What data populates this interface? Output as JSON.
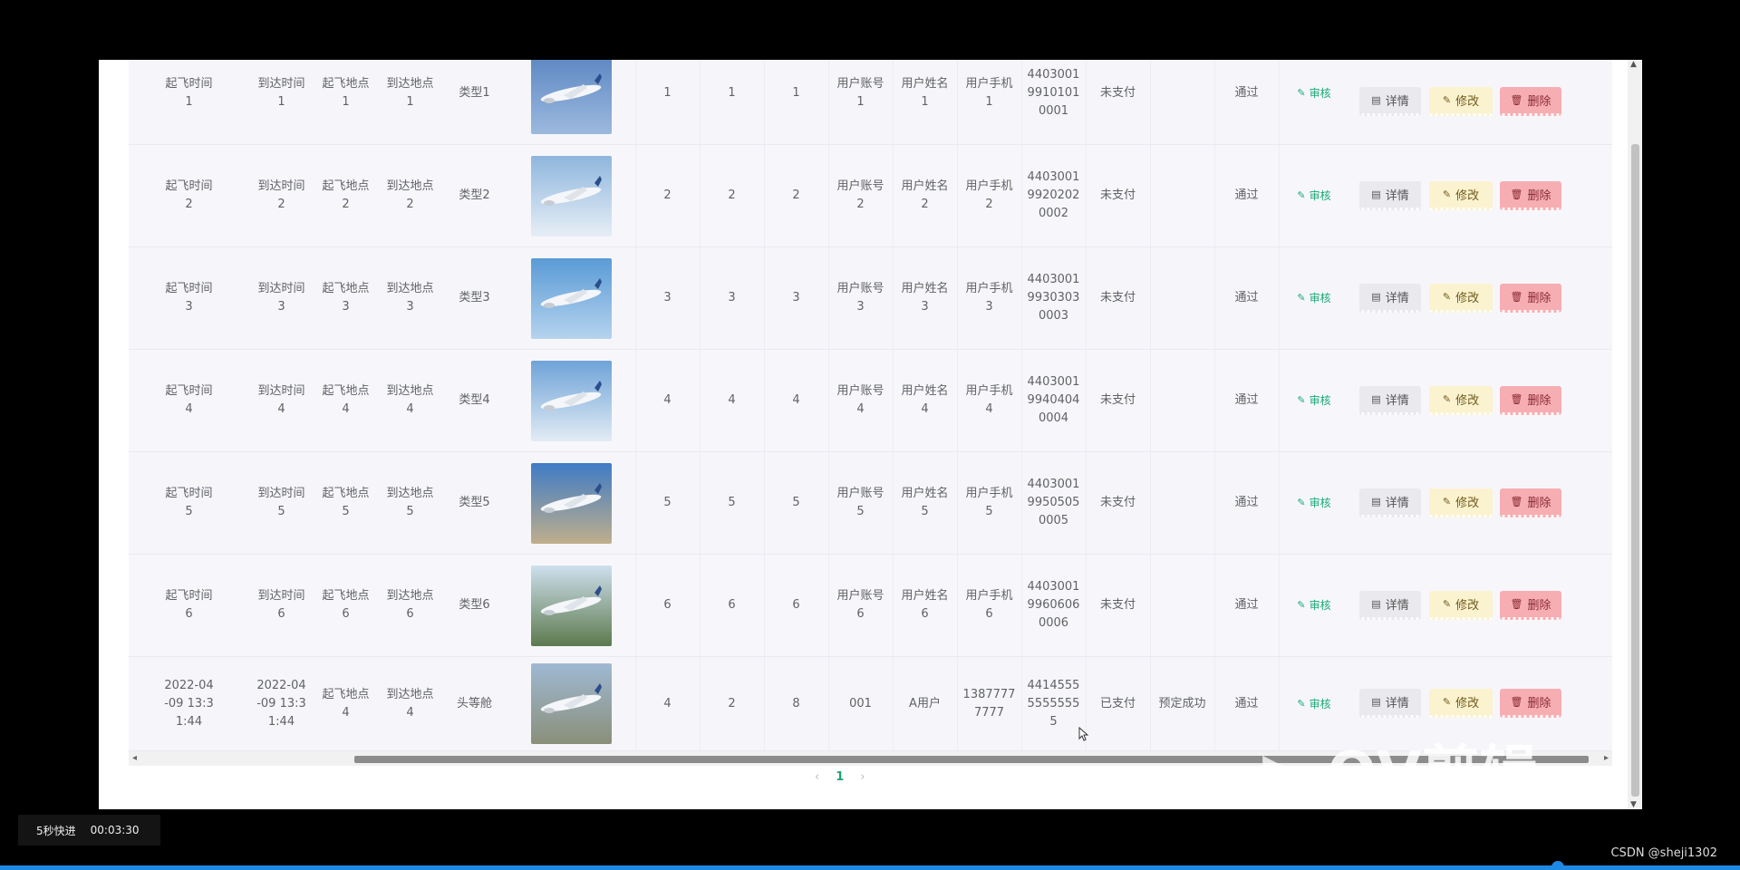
{
  "table": {
    "rows": [
      {
        "dep_time": [
          "起飞时间",
          "1"
        ],
        "arr_time": [
          "到达时间",
          "1"
        ],
        "dep_place": [
          "起飞地点",
          "1"
        ],
        "arr_place": [
          "到达地点",
          "1"
        ],
        "type": "类型1",
        "c1": "1",
        "c2": "1",
        "c3": "1",
        "account": [
          "用户账号",
          "1"
        ],
        "name": [
          "用户姓名",
          "1"
        ],
        "phone": [
          "用户手机",
          "1"
        ],
        "id": [
          "4403001",
          "9910101",
          "0001"
        ],
        "pay": "未支付",
        "status": "",
        "review": "通过",
        "audit": "审核",
        "detail": "详情",
        "edit": "修改",
        "del": "删除"
      },
      {
        "dep_time": [
          "起飞时间",
          "2"
        ],
        "arr_time": [
          "到达时间",
          "2"
        ],
        "dep_place": [
          "起飞地点",
          "2"
        ],
        "arr_place": [
          "到达地点",
          "2"
        ],
        "type": "类型2",
        "c1": "2",
        "c2": "2",
        "c3": "2",
        "account": [
          "用户账号",
          "2"
        ],
        "name": [
          "用户姓名",
          "2"
        ],
        "phone": [
          "用户手机",
          "2"
        ],
        "id": [
          "4403001",
          "9920202",
          "0002"
        ],
        "pay": "未支付",
        "status": "",
        "review": "通过",
        "audit": "审核",
        "detail": "详情",
        "edit": "修改",
        "del": "删除"
      },
      {
        "dep_time": [
          "起飞时间",
          "3"
        ],
        "arr_time": [
          "到达时间",
          "3"
        ],
        "dep_place": [
          "起飞地点",
          "3"
        ],
        "arr_place": [
          "到达地点",
          "3"
        ],
        "type": "类型3",
        "c1": "3",
        "c2": "3",
        "c3": "3",
        "account": [
          "用户账号",
          "3"
        ],
        "name": [
          "用户姓名",
          "3"
        ],
        "phone": [
          "用户手机",
          "3"
        ],
        "id": [
          "4403001",
          "9930303",
          "0003"
        ],
        "pay": "未支付",
        "status": "",
        "review": "通过",
        "audit": "审核",
        "detail": "详情",
        "edit": "修改",
        "del": "删除"
      },
      {
        "dep_time": [
          "起飞时间",
          "4"
        ],
        "arr_time": [
          "到达时间",
          "4"
        ],
        "dep_place": [
          "起飞地点",
          "4"
        ],
        "arr_place": [
          "到达地点",
          "4"
        ],
        "type": "类型4",
        "c1": "4",
        "c2": "4",
        "c3": "4",
        "account": [
          "用户账号",
          "4"
        ],
        "name": [
          "用户姓名",
          "4"
        ],
        "phone": [
          "用户手机",
          "4"
        ],
        "id": [
          "4403001",
          "9940404",
          "0004"
        ],
        "pay": "未支付",
        "status": "",
        "review": "通过",
        "audit": "审核",
        "detail": "详情",
        "edit": "修改",
        "del": "删除"
      },
      {
        "dep_time": [
          "起飞时间",
          "5"
        ],
        "arr_time": [
          "到达时间",
          "5"
        ],
        "dep_place": [
          "起飞地点",
          "5"
        ],
        "arr_place": [
          "到达地点",
          "5"
        ],
        "type": "类型5",
        "c1": "5",
        "c2": "5",
        "c3": "5",
        "account": [
          "用户账号",
          "5"
        ],
        "name": [
          "用户姓名",
          "5"
        ],
        "phone": [
          "用户手机",
          "5"
        ],
        "id": [
          "4403001",
          "9950505",
          "0005"
        ],
        "pay": "未支付",
        "status": "",
        "review": "通过",
        "audit": "审核",
        "detail": "详情",
        "edit": "修改",
        "del": "删除"
      },
      {
        "dep_time": [
          "起飞时间",
          "6"
        ],
        "arr_time": [
          "到达时间",
          "6"
        ],
        "dep_place": [
          "起飞地点",
          "6"
        ],
        "arr_place": [
          "到达地点",
          "6"
        ],
        "type": "类型6",
        "c1": "6",
        "c2": "6",
        "c3": "6",
        "account": [
          "用户账号",
          "6"
        ],
        "name": [
          "用户姓名",
          "6"
        ],
        "phone": [
          "用户手机",
          "6"
        ],
        "id": [
          "4403001",
          "9960606",
          "0006"
        ],
        "pay": "未支付",
        "status": "",
        "review": "通过",
        "audit": "审核",
        "detail": "详情",
        "edit": "修改",
        "del": "删除"
      },
      {
        "dep_time": [
          "2022-04",
          "-09 13:3",
          "1:44"
        ],
        "arr_time": [
          "2022-04",
          "-09 13:3",
          "1:44"
        ],
        "dep_place": [
          "起飞地点",
          "4"
        ],
        "arr_place": [
          "到达地点",
          "4"
        ],
        "type": "头等舱",
        "c1": "4",
        "c2": "2",
        "c3": "8",
        "account": [
          "001"
        ],
        "name": [
          "A用户"
        ],
        "phone": [
          "1387777",
          "7777"
        ],
        "id": [
          "4414555",
          "5555555",
          "5"
        ],
        "pay": "已支付",
        "status": "预定成功",
        "review": "通过",
        "audit": "审核",
        "detail": "详情",
        "edit": "修改",
        "del": "删除"
      }
    ]
  },
  "pagination": {
    "current": "1",
    "prev": "‹",
    "next": "›"
  },
  "overlay": {
    "fast_forward": "5秒快进",
    "timestamp": "00:03:30",
    "credit": "CSDN @sheji1302"
  },
  "watermark": "QV剪辑",
  "colors": {
    "accent": "#1aa37a",
    "edit_bg": "#fbf2cf",
    "delete_bg": "#f6aeb3",
    "detail_bg": "#e9e9ee"
  }
}
